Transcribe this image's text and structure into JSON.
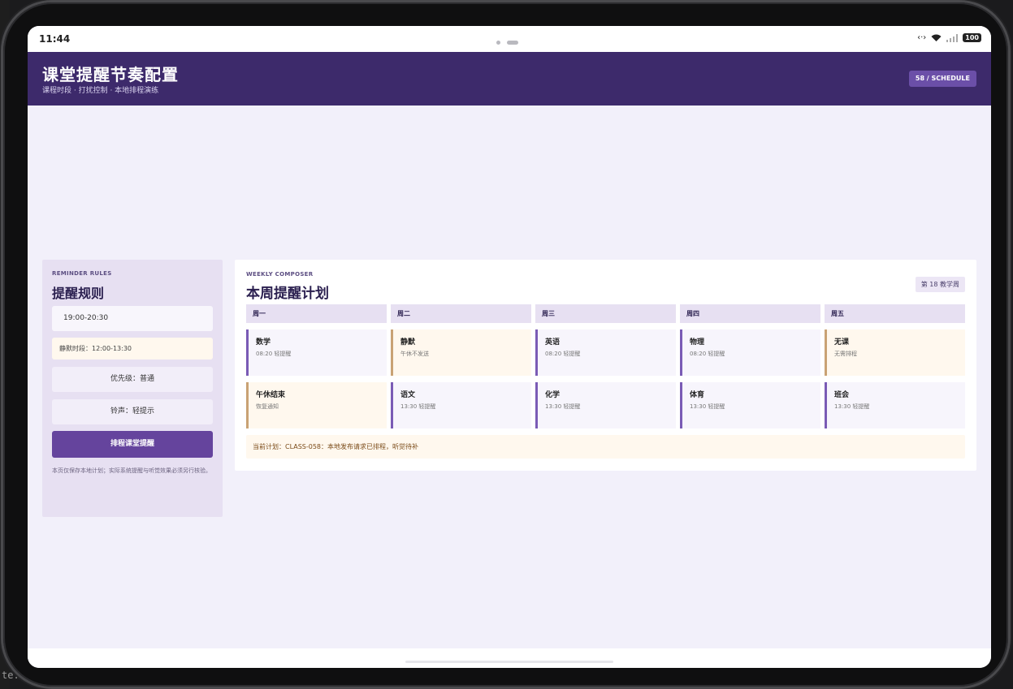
{
  "ide": {
    "bottom_text": "te."
  },
  "status": {
    "time": "11:44",
    "battery": "100"
  },
  "header": {
    "title": "课堂提醒节奏配置",
    "subtitle": "课程时段 · 打扰控制 · 本地排程演练",
    "chip": "58 / SCHEDULE"
  },
  "rules": {
    "kicker": "REMINDER RULES",
    "title": "提醒规则",
    "time_value": "19:00-20:30",
    "quiet_text": "静默时段：12:00-13:30",
    "priority_text": "优先级：普通",
    "ringtone_text": "铃声：轻提示",
    "schedule_button": "排程课堂提醒",
    "note": "本页仅保存本地计划；实际系统提醒与听觉效果必须另行核验。"
  },
  "composer": {
    "kicker": "WEEKLY COMPOSER",
    "title": "本周提醒计划",
    "week_badge": "第 18 教学周",
    "days": [
      "周一",
      "周二",
      "周三",
      "周四",
      "周五"
    ],
    "row1": [
      {
        "title": "数学",
        "meta": "08:20 轻提醒",
        "kind": "normal"
      },
      {
        "title": "静默",
        "meta": "午休不发送",
        "kind": "quiet"
      },
      {
        "title": "英语",
        "meta": "08:20 轻提醒",
        "kind": "normal"
      },
      {
        "title": "物理",
        "meta": "08:20 轻提醒",
        "kind": "normal"
      },
      {
        "title": "无课",
        "meta": "无需排程",
        "kind": "quiet"
      }
    ],
    "row2": [
      {
        "title": "午休结束",
        "meta": "恢复通知",
        "kind": "quiet"
      },
      {
        "title": "语文",
        "meta": "13:30 轻提醒",
        "kind": "normal"
      },
      {
        "title": "化学",
        "meta": "13:30 轻提醒",
        "kind": "normal"
      },
      {
        "title": "体育",
        "meta": "13:30 轻提醒",
        "kind": "normal"
      },
      {
        "title": "班会",
        "meta": "13:30 轻提醒",
        "kind": "normal"
      }
    ],
    "plan_text": "当前计划：CLASS-058：本地发布请求已排程，听觉待补"
  }
}
